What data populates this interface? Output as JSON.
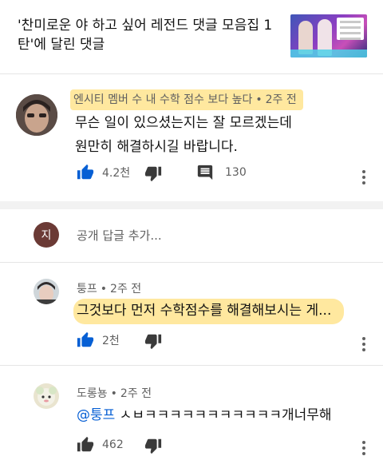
{
  "video": {
    "title": "'찬미로운 야 하고 싶어 레전드 댓글 모음집 1탄'에 달린 댓글"
  },
  "main_comment": {
    "author": "엔시티 멤버 수 내 수학 점수 보다 높다",
    "time": "2주 전",
    "text_line1": "무슨 일이 있으셨는지는 잘 모르겠는데",
    "text_line2": "원만히 해결하시길 바랍니다.",
    "likes": "4.2천",
    "replies": "130"
  },
  "reply_input": {
    "avatar_letter": "지",
    "placeholder": "공개 답글 추가..."
  },
  "replies": [
    {
      "author": "퉁프",
      "time": "2주 전",
      "text": "그것보다 먼저 수학점수를 해결해보시는 게...",
      "likes": "2천"
    },
    {
      "author": "도롱뇽",
      "time": "2주 전",
      "mention": "@퉁프",
      "text": " ㅅㅂㅋㅋㅋㅋㅋㅋㅋㅋㅋㅋㅋ개너무해",
      "likes": "462"
    }
  ],
  "colors": {
    "highlight": "#ffd650",
    "mention": "#065fd4",
    "like_active": "#065fd4",
    "icon_gray": "#606060"
  },
  "icons": [
    "thumb-up-icon",
    "thumb-down-icon",
    "comment-icon",
    "more-vert-icon"
  ]
}
